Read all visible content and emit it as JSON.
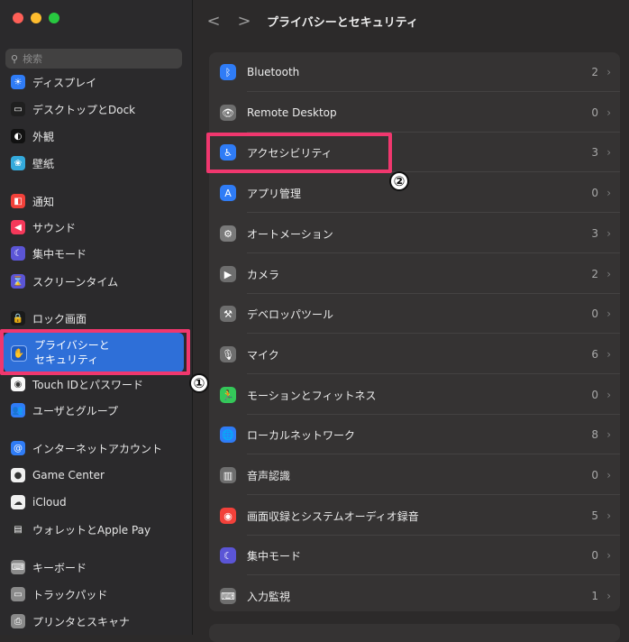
{
  "colors": {
    "selection": "#2e6fd8",
    "highlight_frame": "#f0376e"
  },
  "search": {
    "placeholder": "検索"
  },
  "header": {
    "title": "プライバシーとセキュリティ",
    "back": "<",
    "forward": ">"
  },
  "annotations": {
    "one": "①",
    "two": "②"
  },
  "sidebar": {
    "items": [
      {
        "label": "ディスプレイ",
        "icon": "display-icon",
        "color": "#2f7cf6",
        "glyph": "☀"
      },
      {
        "label": "デスクトップとDock",
        "icon": "dock-icon",
        "color": "#1f1f1f",
        "glyph": "▭"
      },
      {
        "label": "外観",
        "icon": "appearance-icon",
        "color": "#111111",
        "glyph": "◐"
      },
      {
        "label": "壁紙",
        "icon": "wallpaper-icon",
        "color": "#34aadc",
        "glyph": "❀"
      },
      {
        "label": "通知",
        "icon": "notification-icon",
        "color": "#f2413a",
        "glyph": "◧"
      },
      {
        "label": "サウンド",
        "icon": "sound-icon",
        "color": "#f5385a",
        "glyph": "◀"
      },
      {
        "label": "集中モード",
        "icon": "focus-icon",
        "color": "#5b55d6",
        "glyph": "☾"
      },
      {
        "label": "スクリーンタイム",
        "icon": "screentime-icon",
        "color": "#5b55d6",
        "glyph": "⌛"
      },
      {
        "label": "ロック画面",
        "icon": "lock-screen-icon",
        "color": "#1a1a1a",
        "glyph": "🔒"
      },
      {
        "label": "Touch IDとパスワード",
        "icon": "touchid-icon",
        "color": "#f8f8f8",
        "glyph": "◉"
      },
      {
        "label": "ユーザとグループ",
        "icon": "users-icon",
        "color": "#2f7cf6",
        "glyph": "👥"
      },
      {
        "label": "インターネットアカウント",
        "icon": "internet-accounts-icon",
        "color": "#2f7cf6",
        "glyph": "@"
      },
      {
        "label": "Game Center",
        "icon": "game-center-icon",
        "color": "#f0f0f0",
        "glyph": "●"
      },
      {
        "label": "iCloud",
        "icon": "icloud-icon",
        "color": "#f0f0f0",
        "glyph": "☁"
      },
      {
        "label": "ウォレットとApple Pay",
        "icon": "wallet-icon",
        "color": "#2b2b2b",
        "glyph": "▤"
      },
      {
        "label": "キーボード",
        "icon": "keyboard-icon",
        "color": "#8a8a8a",
        "glyph": "⌨"
      },
      {
        "label": "トラックパッド",
        "icon": "trackpad-icon",
        "color": "#8a8a8a",
        "glyph": "▭"
      },
      {
        "label": "プリンタとスキャナ",
        "icon": "printer-icon",
        "color": "#8a8a8a",
        "glyph": "⎙"
      }
    ],
    "selected": {
      "label_line1": "プライバシーと",
      "label_line2": "セキュリティ",
      "icon": "hand-icon",
      "glyph": "✋"
    }
  },
  "rows": [
    {
      "label": "Bluetooth",
      "count": "2",
      "icon": "bluetooth-icon",
      "color": "#2f7cf6",
      "glyph": "ᛒ"
    },
    {
      "label": "Remote Desktop",
      "count": "0",
      "icon": "remote-desktop-icon",
      "color": "#6e6e6e",
      "glyph": "👁"
    },
    {
      "label": "アクセシビリティ",
      "count": "3",
      "icon": "accessibility-icon",
      "color": "#2f7cf6",
      "glyph": "♿"
    },
    {
      "label": "アプリ管理",
      "count": "0",
      "icon": "app-management-icon",
      "color": "#2f7cf6",
      "glyph": "A"
    },
    {
      "label": "オートメーション",
      "count": "3",
      "icon": "automation-icon",
      "color": "#7a7a7a",
      "glyph": "⚙"
    },
    {
      "label": "カメラ",
      "count": "2",
      "icon": "camera-icon",
      "color": "#6e6e6e",
      "glyph": "▶"
    },
    {
      "label": "デベロッパツール",
      "count": "0",
      "icon": "developer-tools-icon",
      "color": "#6e6e6e",
      "glyph": "⚒"
    },
    {
      "label": "マイク",
      "count": "6",
      "icon": "microphone-icon",
      "color": "#6e6e6e",
      "glyph": "🎙"
    },
    {
      "label": "モーションとフィットネス",
      "count": "0",
      "icon": "motion-fitness-icon",
      "color": "#34c759",
      "glyph": "🏃"
    },
    {
      "label": "ローカルネットワーク",
      "count": "8",
      "icon": "local-network-icon",
      "color": "#2f7cf6",
      "glyph": "🌐"
    },
    {
      "label": "音声認識",
      "count": "0",
      "icon": "speech-recognition-icon",
      "color": "#6e6e6e",
      "glyph": "▥"
    },
    {
      "label": "画面収録とシステムオーディオ録音",
      "count": "5",
      "icon": "screen-recording-icon",
      "color": "#f2413a",
      "glyph": "◉"
    },
    {
      "label": "集中モード",
      "count": "0",
      "icon": "focus-icon",
      "color": "#5b55d6",
      "glyph": "☾"
    },
    {
      "label": "入力監視",
      "count": "1",
      "icon": "input-monitoring-icon",
      "color": "#6e6e6e",
      "glyph": "⌨"
    }
  ]
}
